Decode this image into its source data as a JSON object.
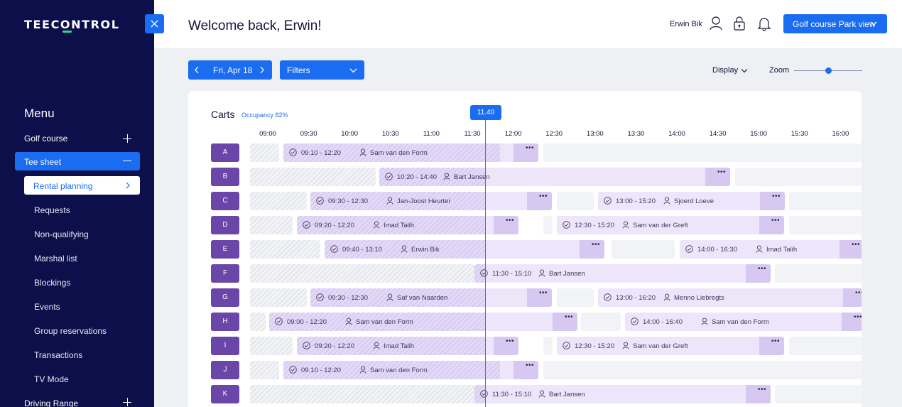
{
  "sidebar": {
    "logo": "TEECONTROL",
    "menu_title": "Menu",
    "golf_course": "Golf course",
    "tee_sheet": "Tee sheet",
    "rental_planning": "Rental planning",
    "sub_items": [
      "Requests",
      "Non-qualifying",
      "Marshal list",
      "Blockings",
      "Events",
      "Group reservations",
      "Transactions",
      "TV Mode"
    ],
    "driving_range": "Driving Range"
  },
  "header": {
    "welcome": "Welcome back, Erwin!",
    "user_name": "Erwin Bik",
    "course_button": "Golf course Park view"
  },
  "toolbar": {
    "date": "Fri, Apr 18",
    "filters": "Filters",
    "display": "Display",
    "zoom": "Zoom",
    "zoom_level": 0.5
  },
  "planner": {
    "title": "Carts",
    "occupancy": "Occupancy 82%",
    "now": "11.40",
    "times": [
      "09:00",
      "09:30",
      "10:00",
      "10:30",
      "11:00",
      "11:30",
      "12:00",
      "12:30",
      "13:00",
      "13:30",
      "14:00",
      "14:30",
      "15:00",
      "15:30",
      "16:00"
    ],
    "carts": [
      {
        "label": "A",
        "reservations": [
          {
            "time": "09.10 - 12:20",
            "name": "Sam van den Form"
          }
        ]
      },
      {
        "label": "B",
        "reservations": [
          {
            "time": "10:20 - 14:40",
            "name": "Bart Jansen"
          }
        ]
      },
      {
        "label": "C",
        "reservations": [
          {
            "time": "09:30 - 12:30",
            "name": "Jan-Joost Heurter"
          },
          {
            "time": "13:00 - 15:20",
            "name": "Sjoerd Loeve"
          }
        ]
      },
      {
        "label": "D",
        "reservations": [
          {
            "time": "09:20 - 12:20",
            "name": "Imad Talih"
          },
          {
            "time": "12:30 - 15:20",
            "name": "Sam van der Greft"
          }
        ]
      },
      {
        "label": "E",
        "reservations": [
          {
            "time": "09:40 - 13:10",
            "name": "Erwin Bik"
          },
          {
            "time": "14:00 - 16:30",
            "name": "Imad Talih"
          }
        ]
      },
      {
        "label": "F",
        "reservations": [
          {
            "time": "11:30 - 15:10",
            "name": "Bart Jansen"
          }
        ]
      },
      {
        "label": "G",
        "reservations": [
          {
            "time": "09:30 - 12:30",
            "name": "Saf van Naarden"
          },
          {
            "time": "13:00 - 16:20",
            "name": "Menno Liebregts"
          }
        ]
      },
      {
        "label": "H",
        "reservations": [
          {
            "time": "09:00 - 12:20",
            "name": "Sam van den Form"
          },
          {
            "time": "14:00 - 16:40",
            "name": "Sam van den Form"
          }
        ]
      },
      {
        "label": "I",
        "reservations": [
          {
            "time": "09:20 - 12:20",
            "name": "Imad Talih"
          },
          {
            "time": "12:30 - 15:20",
            "name": "Sam van der Greft"
          }
        ]
      },
      {
        "label": "J",
        "reservations": [
          {
            "time": "09.10 - 12:20",
            "name": "Sam van den Form"
          }
        ]
      },
      {
        "label": "K",
        "reservations": [
          {
            "time": "11:30 - 15:10",
            "name": "Bart Jansen"
          }
        ]
      }
    ]
  }
}
